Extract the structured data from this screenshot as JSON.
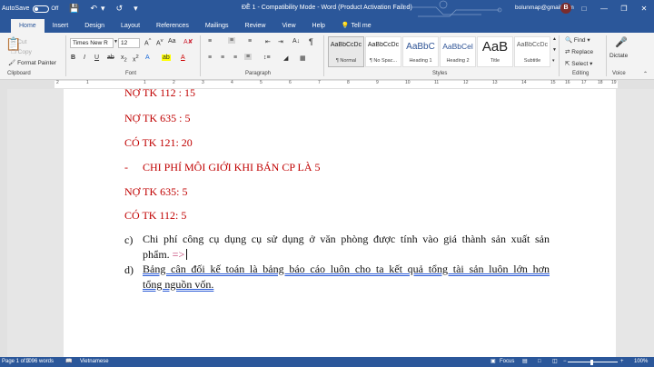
{
  "titlebar": {
    "autosave_label": "AutoSave",
    "autosave_state": "Off",
    "doc_title": "ĐỀ 1  -  Compatibility Mode  -  Word (Product Activation Failed)",
    "user": "bolunmap@gmail.com",
    "avatar_letter": "B"
  },
  "tabs": [
    "File",
    "Home",
    "Insert",
    "Design",
    "Layout",
    "References",
    "Mailings",
    "Review",
    "View",
    "Help",
    "Tell me"
  ],
  "clipboard": {
    "paste": "Paste",
    "cut": "Cut",
    "copy": "Copy",
    "format_painter": "Format Painter",
    "label": "Clipboard"
  },
  "font": {
    "name": "Times New R",
    "size": "12",
    "label": "Font"
  },
  "paragraph": {
    "label": "Paragraph"
  },
  "styles": {
    "label": "Styles",
    "items": [
      {
        "preview": "AaBbCcDc",
        "name": "¶ Normal"
      },
      {
        "preview": "AaBbCcDc",
        "name": "¶ No Spac..."
      },
      {
        "preview": "AaBbC",
        "name": "Heading 1"
      },
      {
        "preview": "AaBbCel",
        "name": "Heading 2"
      },
      {
        "preview": "AaB",
        "name": "Title"
      },
      {
        "preview": "AaBbCcDc",
        "name": "Subtitle"
      }
    ]
  },
  "editing": {
    "find": "Find",
    "replace": "Replace",
    "select": "Select",
    "label": "Editing"
  },
  "voice": {
    "dictate": "Dictate",
    "label": "Voice"
  },
  "ruler_numbers": [
    "2",
    "1",
    "1",
    "2",
    "3",
    "4",
    "5",
    "6",
    "7",
    "8",
    "9",
    "10",
    "11",
    "12",
    "13",
    "14",
    "15",
    "16",
    "17",
    "18",
    "19"
  ],
  "document": {
    "line1": "NỢ TK 112 : 15",
    "line2": "NỢ TK 635 : 5",
    "line3": "CÓ TK 121: 20",
    "dash": "-",
    "line4": "CHI PHÍ MÔI GIỚI KHI BÁN CP LÀ 5",
    "line5": "NỢ TK 635: 5",
    "line6": "CÓ TK 112: 5",
    "c_marker": "c)",
    "c_text1": "Chi phí công cụ dụng cụ sử dụng ở văn phòng được tính vào giá thành sản xuất sản",
    "c_text2": "phẩm.",
    "c_arrow": "=>",
    "d_marker": "d)",
    "d_text1": "Bảng cân đối kế toán là bảng báo cáo luôn cho ta kết quả tổng tài sản luôn lớn hơn",
    "d_text2": "tổng nguồn vốn."
  },
  "statusbar": {
    "page": "Page 1 of 3",
    "words": "1096 words",
    "language": "Vietnamese",
    "focus": "Focus",
    "zoom": "100%"
  },
  "colors": {
    "word_blue": "#2b579a",
    "doc_red": "#c00000",
    "arrow_pink": "#c0356b"
  }
}
